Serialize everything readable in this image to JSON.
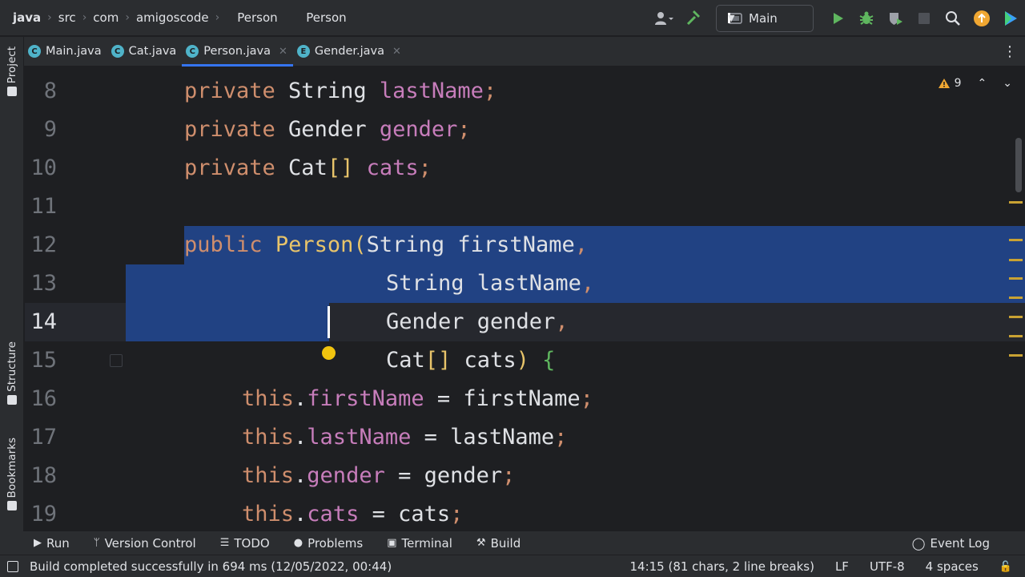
{
  "breadcrumbs": [
    "java",
    "src",
    "com",
    "amigoscode",
    "Person",
    "Person"
  ],
  "run_config": {
    "label": "Main"
  },
  "tabs": [
    {
      "label": "Main.java",
      "icon": "class-icon",
      "color": "#4fb3c9",
      "active": false
    },
    {
      "label": "Cat.java",
      "icon": "class-icon",
      "color": "#4fb3c9",
      "active": false
    },
    {
      "label": "Person.java",
      "icon": "class-icon",
      "color": "#4fb3c9",
      "active": true
    },
    {
      "label": "Gender.java",
      "icon": "enum-icon",
      "color": "#4fb3c9",
      "active": false
    }
  ],
  "side_panels": {
    "project": "Project",
    "structure": "Structure",
    "bookmarks": "Bookmarks"
  },
  "inspections": {
    "warnings": "9"
  },
  "editor": {
    "line_numbers": [
      "8",
      "9",
      "10",
      "11",
      "12",
      "13",
      "14",
      "15",
      "16",
      "17",
      "18",
      "19"
    ],
    "current_line": "14",
    "lines": [
      "private String lastName;",
      "private Gender gender;",
      "private Cat[] cats;",
      "",
      "public Person(String firstName,",
      "String lastName,",
      "Gender gender,",
      "Cat[] cats) {",
      "this.firstName = firstName;",
      "this.lastName = lastName;",
      "this.gender = gender;",
      "this.cats = cats;"
    ],
    "code_tokens": {
      "l8": [
        "private",
        " String ",
        "lastName",
        ";"
      ],
      "l9": [
        "private",
        " Gender ",
        "gender",
        ";"
      ],
      "l10": [
        "private",
        " Cat",
        "[]",
        " cats",
        ";"
      ],
      "l12": [
        "public",
        " ",
        "Person",
        "(",
        "String firstName",
        ","
      ],
      "l13": [
        "String lastName",
        ","
      ],
      "l14": [
        "Gender gender",
        ","
      ],
      "l15": [
        "Cat",
        "[]",
        " cats",
        ")",
        " ",
        "{"
      ],
      "l16": [
        "this",
        ".",
        "firstName",
        " = firstName",
        ";"
      ],
      "l17": [
        "this",
        ".",
        "lastName",
        " = lastName",
        ";"
      ],
      "l18": [
        "this",
        ".",
        "gender",
        " = gender",
        ";"
      ],
      "l19": [
        "this",
        ".",
        "cats",
        " = cats",
        ";"
      ]
    }
  },
  "tool_windows": [
    "Run",
    "Version Control",
    "TODO",
    "Problems",
    "Terminal",
    "Build"
  ],
  "event_log": "Event Log",
  "status": {
    "message": "Build completed successfully in 694 ms (12/05/2022, 00:44)",
    "position": "14:15 (81 chars, 2 line breaks)",
    "line_sep": "LF",
    "encoding": "UTF-8",
    "indent": "4 spaces"
  },
  "colors": {
    "keyword": "#cf8e6d",
    "field": "#c77dbb",
    "selection": "#214283",
    "accent": "#3574f0"
  }
}
